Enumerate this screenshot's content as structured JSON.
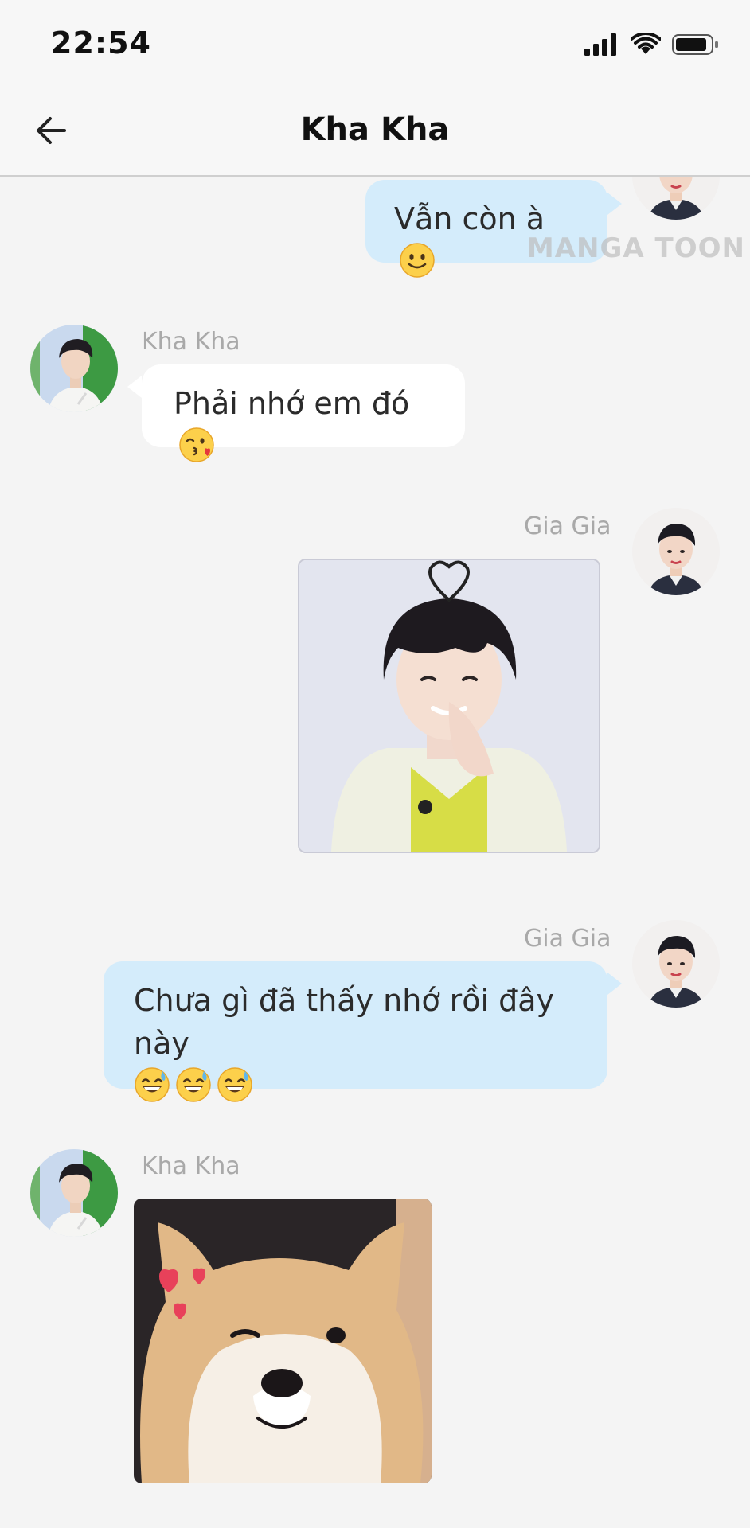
{
  "status_bar": {
    "time": "22:54",
    "icons": [
      "signal-icon",
      "wifi-icon",
      "battery-icon"
    ]
  },
  "nav": {
    "title": "Kha Kha",
    "back_icon": "arrow-left-icon"
  },
  "watermark": "MANGA TOON",
  "colors": {
    "my_bubble": "#d4ecfb",
    "their_bubble": "#ffffff",
    "background": "#f4f4f4",
    "sender_name": "#a9a9a9"
  },
  "messages": [
    {
      "sender": "",
      "side": "right",
      "type": "text",
      "text": "Vẫn còn à",
      "emoji": "slightly-smiling-face"
    },
    {
      "sender": "Kha Kha",
      "side": "left",
      "type": "text",
      "text": "Phải nhớ em đó",
      "emoji": "face-blowing-kiss"
    },
    {
      "sender": "Gia Gia",
      "side": "right",
      "type": "image",
      "image": "photo-boy-heart"
    },
    {
      "sender": "Gia Gia",
      "side": "right",
      "type": "text",
      "text": "Chưa gì đã thấy nhớ rồi đây này",
      "emoji": "grinning-sweat-face x3"
    },
    {
      "sender": "Kha Kha",
      "side": "left",
      "type": "image",
      "image": "photo-shiba-dog-wink"
    }
  ]
}
